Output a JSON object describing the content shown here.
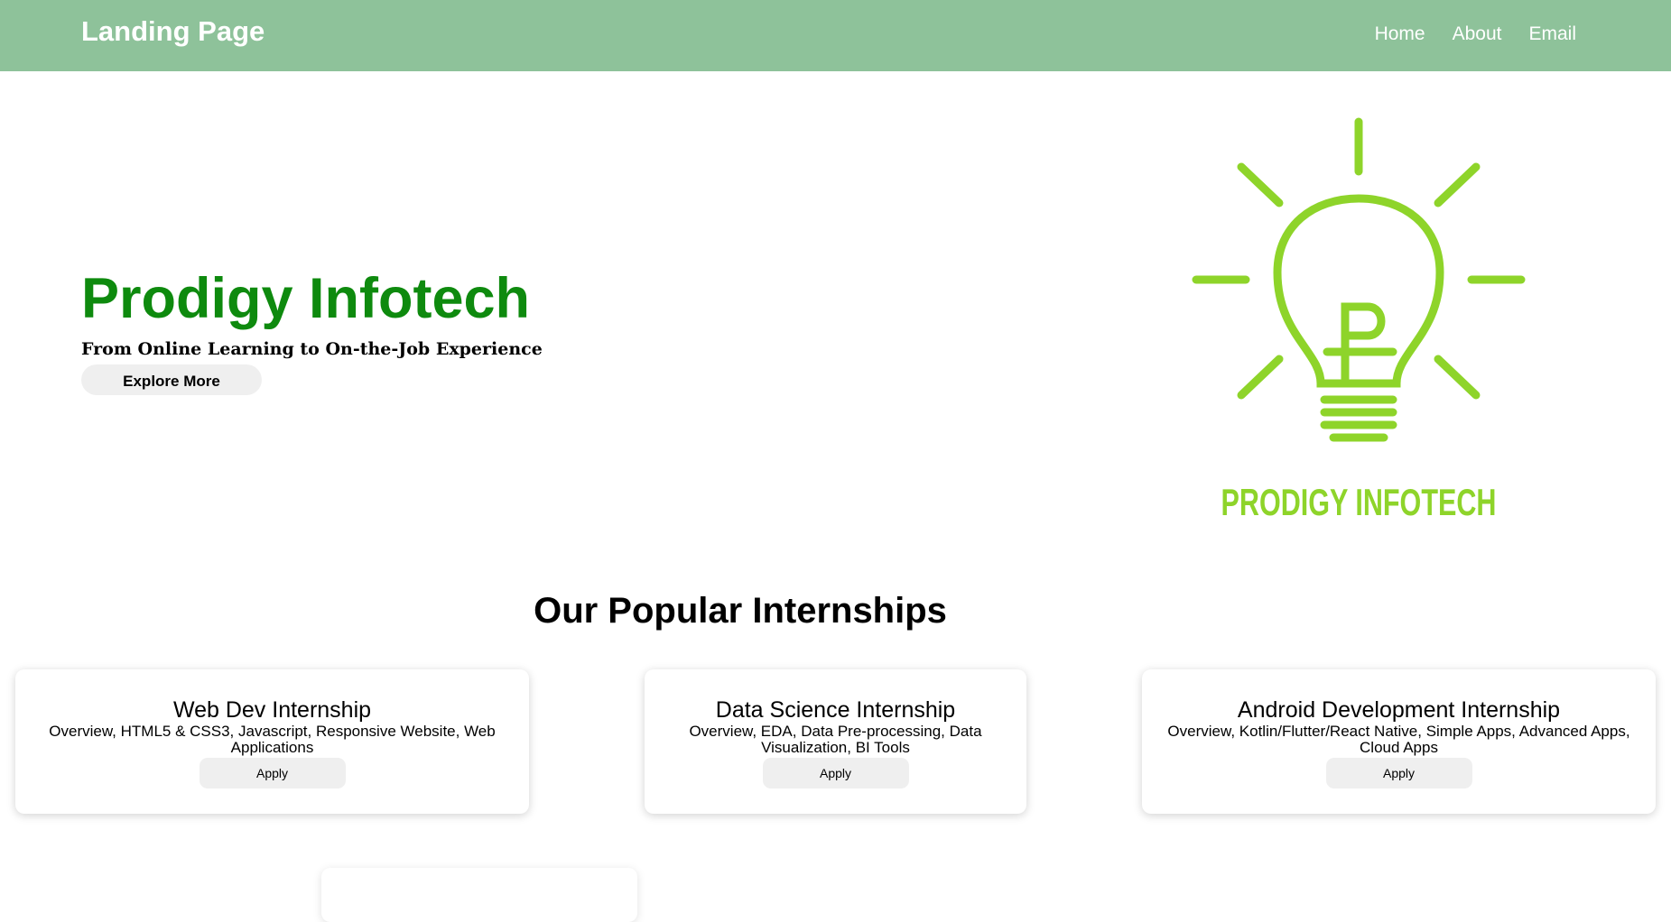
{
  "header": {
    "brand": "Landing Page",
    "nav": [
      "Home",
      "About",
      "Email"
    ]
  },
  "hero": {
    "title": "Prodigy Infotech",
    "subtitle": "From Online Learning to On-the-Job Experience",
    "button_label": "Explore More",
    "logo_text": "PRODIGY INFOTECH",
    "logo_icon": "lightbulb-icon",
    "logo_color": "#8ed42a",
    "title_color": "#0e8a0e"
  },
  "section": {
    "title": "Our Popular Internships"
  },
  "internships": [
    {
      "title": "Web Dev Internship",
      "description": "Overview, HTML5 & CSS3, Javascript, Responsive Website, Web Applications",
      "apply_label": "Apply"
    },
    {
      "title": "Data Science Internship",
      "description": "Overview, EDA, Data Pre-processing, Data Visualization, BI Tools",
      "apply_label": "Apply"
    },
    {
      "title": "Android Development Internship",
      "description": "Overview, Kotlin/Flutter/React Native, Simple Apps, Advanced Apps, Cloud Apps",
      "apply_label": "Apply"
    }
  ],
  "colors": {
    "header_bg": "#8ec29a",
    "button_bg": "#efefef"
  }
}
